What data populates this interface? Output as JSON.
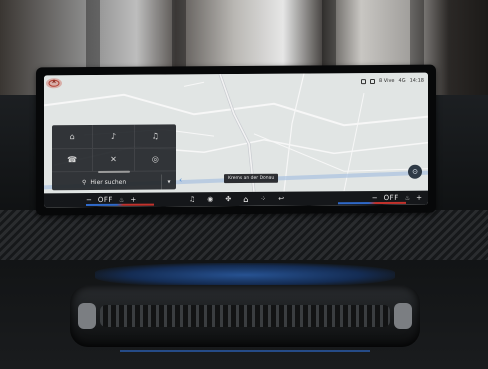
{
  "status": {
    "network": "4G",
    "carrier_text": "8 Vive",
    "time": "14:18"
  },
  "map": {
    "location_label": "Krems an der Donau"
  },
  "panel": {
    "icons": [
      "car-icon",
      "sound-wave-icon",
      "microphone-wave-icon",
      "phone-icon",
      "mute-icon",
      "settings-icon"
    ],
    "search_placeholder": "Hier suchen"
  },
  "climate": {
    "left": {
      "minus": "−",
      "temp": "OFF",
      "plus": "+"
    },
    "right": {
      "minus": "−",
      "temp": "OFF",
      "plus": "+"
    }
  },
  "colors": {
    "heat": "#c2322c",
    "cool": "#2f69c9",
    "accent": "#4c8bd6"
  }
}
